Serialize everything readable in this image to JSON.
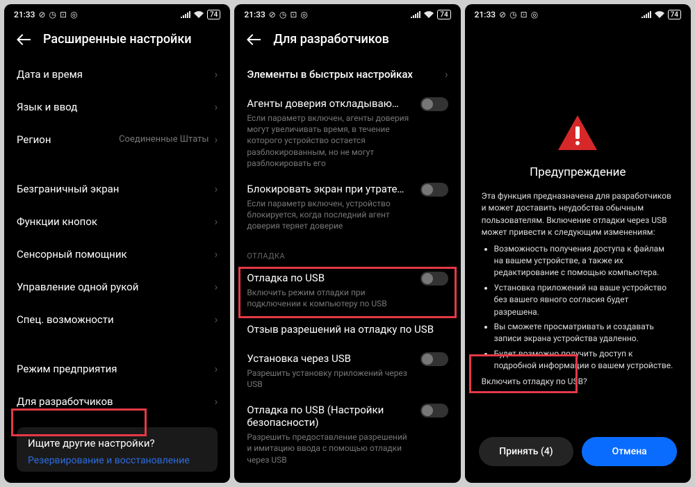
{
  "statusbar": {
    "time": "21:33",
    "battery": "74"
  },
  "screen1": {
    "title": "Расширенные настройки",
    "items": {
      "datetime": "Дата и время",
      "lang": "Язык и ввод",
      "region": "Регион",
      "region_value": "Соединенные Штаты",
      "edgeless": "Безграничный экран",
      "buttons": "Функции кнопок",
      "touch": "Сенсорный помощник",
      "onehand": "Управление одной рукой",
      "accessibility": "Спец. возможности",
      "enterprise": "Режим предприятия",
      "devopts": "Для разработчиков"
    },
    "promo": {
      "question": "Ищите другие настройки?",
      "link": "Резервирование и восстановление"
    }
  },
  "screen2": {
    "title": "Для разработчиков",
    "quick": "Элементы в быстрых настройках",
    "trust": {
      "title": "Агенты доверия откладываю…",
      "desc": "Если параметр включен, агенты доверия могут увеличивать время, в течение которого устройство остается разблокированным, но не могут разблокировать его"
    },
    "lock": {
      "title": "Блокировать экран при утрате…",
      "desc": "Если параметр включен, устройство блокируется, когда последний агент доверия теряет доверие"
    },
    "section_debug": "ОТЛАДКА",
    "usb": {
      "title": "Отладка по USB",
      "desc": "Включить режим отладки при подключении к компьютеру по USB"
    },
    "revoke": "Отзыв разрешений на отладку по USB",
    "install": {
      "title": "Установка через USB",
      "desc": "Разрешить установку приложений через USB"
    },
    "security": {
      "title": "Отладка по USB (Настройки безопасности)",
      "desc": "Разрешить предоставление разрешений и имитацию ввода с помощью отладки через USB"
    }
  },
  "screen3": {
    "title": "Предупреждение",
    "intro": "Эта функция предназначена для разработчиков и может доставить неудобства обычным пользователям. Включение отладки через USB может привести к следующим изменениям:",
    "b1": "Возможность получения доступа к файлам на вашем устройстве, а также их редактирование с помощью компьютера.",
    "b2": "Установка приложений на ваше устройство без вашего явного согласия будет разрешена.",
    "b3": "Вы сможете просматривать и создавать записи экрана устройства удаленно.",
    "b4": "Будет возможно получить доступ к подробной информации о вашем устройстве.",
    "confirm": "Включить отладку по USB?",
    "accept": "Принять (4)",
    "cancel": "Отмена"
  }
}
